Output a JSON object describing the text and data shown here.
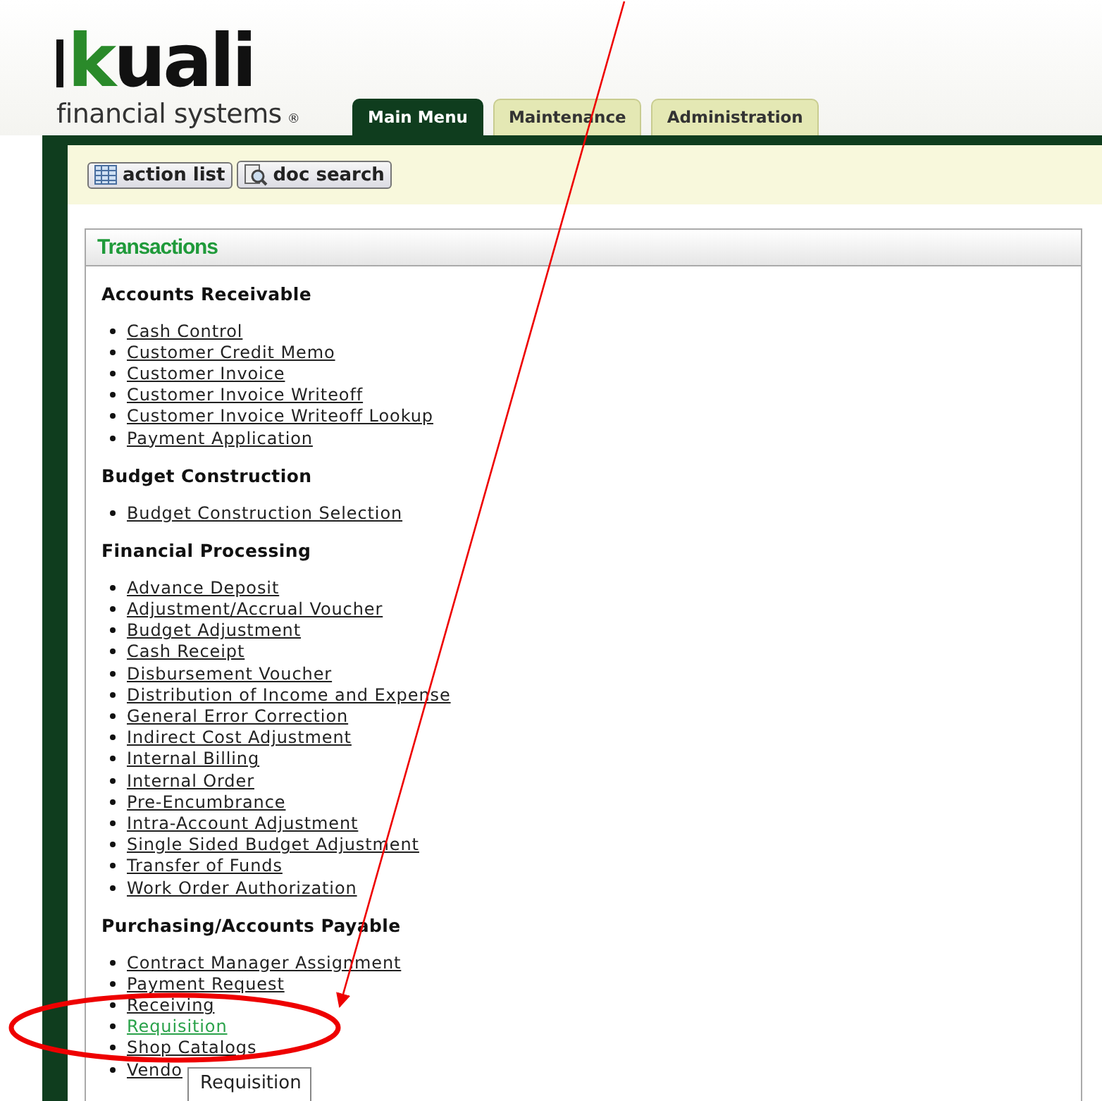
{
  "logo": {
    "wordmark": "kuali",
    "tagline": "financial systems",
    "mark": "®"
  },
  "tabs": [
    {
      "label": "Main Menu",
      "selected": true
    },
    {
      "label": "Maintenance",
      "selected": false
    },
    {
      "label": "Administration",
      "selected": false
    }
  ],
  "toolbar": [
    {
      "label": "action list",
      "kind": "list"
    },
    {
      "label": "doc search",
      "kind": "search"
    }
  ],
  "panel": {
    "title": "Transactions",
    "sections": [
      {
        "heading": "Accounts Receivable",
        "links": [
          {
            "label": "Cash Control",
            "highlighted": false
          },
          {
            "label": "Customer Credit Memo",
            "highlighted": false
          },
          {
            "label": "Customer Invoice",
            "highlighted": false
          },
          {
            "label": "Customer Invoice Writeoff",
            "highlighted": false
          },
          {
            "label": "Customer Invoice Writeoff Lookup",
            "highlighted": false
          },
          {
            "label": "Payment Application",
            "highlighted": false
          }
        ]
      },
      {
        "heading": "Budget Construction",
        "links": [
          {
            "label": "Budget Construction Selection",
            "highlighted": false
          }
        ]
      },
      {
        "heading": "Financial Processing",
        "links": [
          {
            "label": "Advance Deposit",
            "highlighted": false
          },
          {
            "label": "Adjustment/Accrual Voucher",
            "highlighted": false
          },
          {
            "label": "Budget Adjustment",
            "highlighted": false
          },
          {
            "label": "Cash Receipt",
            "highlighted": false
          },
          {
            "label": "Disbursement Voucher",
            "highlighted": false
          },
          {
            "label": "Distribution of Income and Expense",
            "highlighted": false
          },
          {
            "label": "General Error Correction",
            "highlighted": false
          },
          {
            "label": "Indirect Cost Adjustment",
            "highlighted": false
          },
          {
            "label": "Internal Billing",
            "highlighted": false
          },
          {
            "label": "Internal Order",
            "highlighted": false
          },
          {
            "label": "Pre-Encumbrance",
            "highlighted": false
          },
          {
            "label": "Intra-Account Adjustment",
            "highlighted": false
          },
          {
            "label": "Single Sided Budget Adjustment",
            "highlighted": false
          },
          {
            "label": "Transfer of Funds",
            "highlighted": false
          },
          {
            "label": "Work Order Authorization",
            "highlighted": false
          }
        ]
      },
      {
        "heading": "Purchasing/Accounts Payable",
        "links": [
          {
            "label": "Contract Manager Assignment",
            "highlighted": false
          },
          {
            "label": "Payment Request",
            "highlighted": false
          },
          {
            "label": "Receiving",
            "highlighted": false
          },
          {
            "label": "Requisition",
            "highlighted": true
          },
          {
            "label": "Shop Catalogs",
            "highlighted": false
          },
          {
            "label": "Vendo",
            "highlighted": false
          }
        ]
      }
    ]
  },
  "tooltip": "Requisition"
}
